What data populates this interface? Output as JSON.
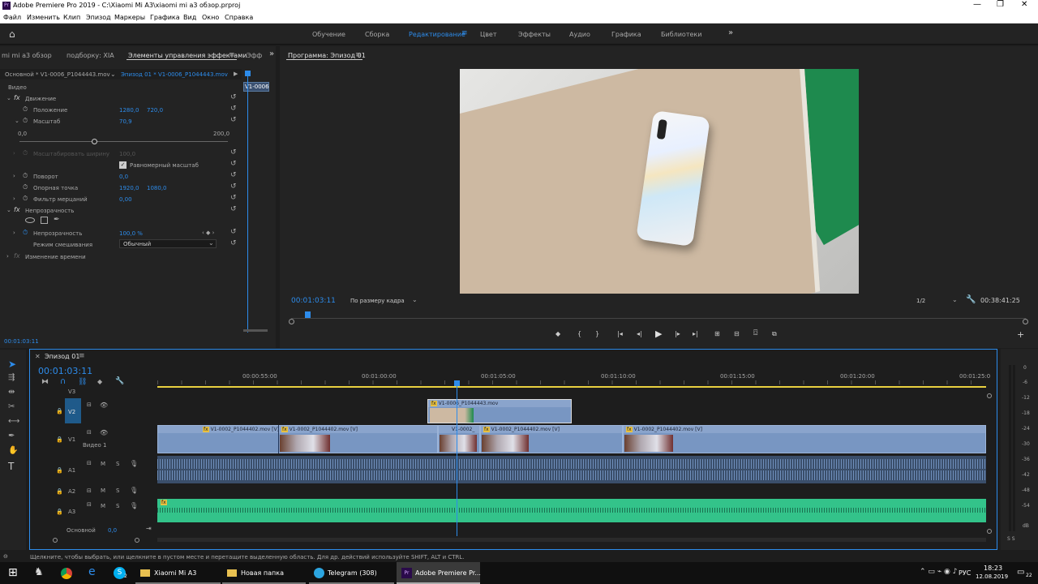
{
  "app": {
    "title": "Adobe Premiere Pro 2019 - C:\\Xiaomi Mi A3\\xiaomi mi a3 обзор.prproj"
  },
  "menu": [
    "Файл",
    "Изменить",
    "Клип",
    "Эпизод",
    "Маркеры",
    "Графика",
    "Вид",
    "Окно",
    "Справка"
  ],
  "workspaces": {
    "tabs": [
      "Обучение",
      "Сборка",
      "Редактирование",
      "Цвет",
      "Эффекты",
      "Аудио",
      "Графика",
      "Библиотеки"
    ],
    "active": "Редактирование",
    "more": "»"
  },
  "source_panel": {
    "tabs": [
      "mi mi a3 обзор",
      "подборку: XIA",
      "Элементы управления эффектами",
      "Эфф"
    ],
    "menu_icon": "≡",
    "more": "»",
    "master": "Основной * V1-0006_P1044443.mov",
    "sequence_clip": "Эпизод 01 * V1-0006_P1044443.mov",
    "mini_clip": "V1-0006",
    "section_video": "Видео",
    "motion": "Движение",
    "fx_mark": "fx",
    "position_label": "Положение",
    "position_x": "1280,0",
    "position_y": "720,0",
    "scale_label": "Масштаб",
    "scale_value": "70,9",
    "slider_min": "0,0",
    "slider_max": "200,0",
    "scale_width_label": "Масштабировать ширину",
    "scale_width_value": "100,0",
    "uniform_label": "Равномерный масштаб",
    "rotation_label": "Поворот",
    "rotation_value": "0,0",
    "anchor_label": "Опорная точка",
    "anchor_x": "1920,0",
    "anchor_y": "1080,0",
    "flicker_label": "Фильтр мерцаний",
    "flicker_value": "0,00",
    "opacity_section": "Непрозрачность",
    "opacity_label": "Непрозрачность",
    "opacity_value": "100,0 %",
    "blend_label": "Режим смешивания",
    "blend_value": "Обычный",
    "timeremap": "Изменение времени",
    "timecode": "00:01:03:11"
  },
  "program": {
    "title": "Программа: Эпизод 01",
    "menu_icon": "≡",
    "timecode": "00:01:03:11",
    "fit": "По размеру кадра",
    "resolution": "1/2",
    "duration": "00:38:41:25",
    "add": "+"
  },
  "timeline": {
    "seq_name": "Эпизод 01",
    "timecode": "00:01:03:11",
    "ruler": [
      "00:00:55:00",
      "00:01:00:00",
      "00:01:05:00",
      "00:01:10:00",
      "00:01:15:00",
      "00:01:20:00",
      "00:01:25:0"
    ],
    "tracks": {
      "v3": "V3",
      "v2": "V2",
      "v1": "V1",
      "v1_name": "Видео 1",
      "a1": "A1",
      "a2": "A2",
      "a3": "A3",
      "m": "M",
      "s": "S",
      "master": "Основной",
      "master_vol": "0,0"
    },
    "v2_clip": "V1-0006_P1044443.mov",
    "v1_clips": [
      "V1-0002_P1044402.mov [V]",
      "V1-0002_P1044402.mov [V]",
      "V1-0002_",
      "V1-0002_P1044402.mov [V]",
      "V1-0002_P1044402.mov [V]"
    ],
    "fx": "fx"
  },
  "meter": {
    "labels": [
      "0",
      "-6",
      "-12",
      "-18",
      "-24",
      "-30",
      "-36",
      "-42",
      "-48",
      "-54",
      "dB"
    ],
    "solo": "S S"
  },
  "status": {
    "text": "Щелкните, чтобы выбрать, или щелкните в пустом месте и перетащите выделенную область. Для др. действий используйте SHIFT, ALT и CTRL."
  },
  "taskbar": {
    "items": [
      "Xiaomi Mi A3",
      "Новая папка",
      "Telegram (308)",
      "Adobe Premiere Pr..."
    ],
    "lang": "РУС",
    "time": "18:23",
    "date": "12.08.2019",
    "notif": "22",
    "skype_badge": "2"
  },
  "colors": {
    "accent": "#2d8ceb",
    "video_clip": "#7896c2",
    "audio_clip": "#3a4e6a",
    "audio_a3": "#33c38a",
    "playhead": "#2d8ceb"
  }
}
